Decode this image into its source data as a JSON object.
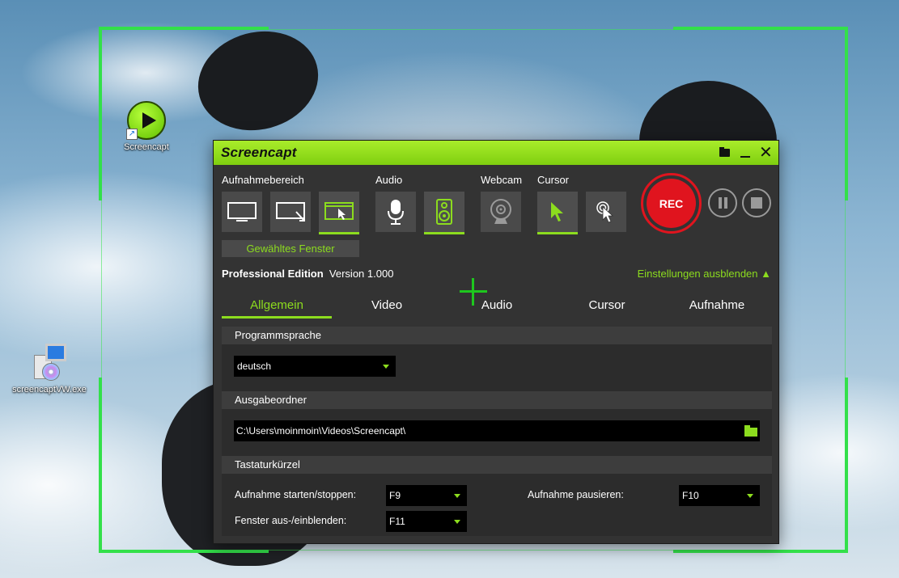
{
  "desktop": {
    "icons": [
      {
        "label": "Screencapt"
      },
      {
        "label": "screencaptVW.exe"
      }
    ]
  },
  "app": {
    "title": "Screencapt",
    "sections": {
      "area": "Aufnahmebereich",
      "audio": "Audio",
      "webcam": "Webcam",
      "cursor": "Cursor"
    },
    "mode_button": "Gewähltes Fenster",
    "rec_label": "REC",
    "edition_name": "Professional Edition",
    "version": "Version 1.000",
    "hide_settings": "Einstellungen ausblenden ▲",
    "tabs": [
      {
        "label": "Allgemein",
        "active": true
      },
      {
        "label": "Video",
        "active": false
      },
      {
        "label": "Audio",
        "active": false
      },
      {
        "label": "Cursor",
        "active": false
      },
      {
        "label": "Aufnahme",
        "active": false
      }
    ],
    "settings": {
      "language_group": "Programmsprache",
      "language_value": "deutsch",
      "output_group": "Ausgabeordner",
      "output_path": "C:\\Users\\moinmoin\\Videos\\Screencapt\\",
      "hotkeys_group": "Tastaturkürzel",
      "hotkeys": {
        "start_stop_label": "Aufnahme starten/stoppen:",
        "start_stop_value": "F9",
        "pause_label": "Aufnahme pausieren:",
        "pause_value": "F10",
        "toggle_window_label": "Fenster aus-/einblenden:",
        "toggle_window_value": "F11"
      }
    }
  },
  "colors": {
    "accent": "#8cdc1e",
    "titlebar": "#7fcf10",
    "rec": "#e0141e",
    "panel": "#333333",
    "frame": "#33e04a"
  }
}
